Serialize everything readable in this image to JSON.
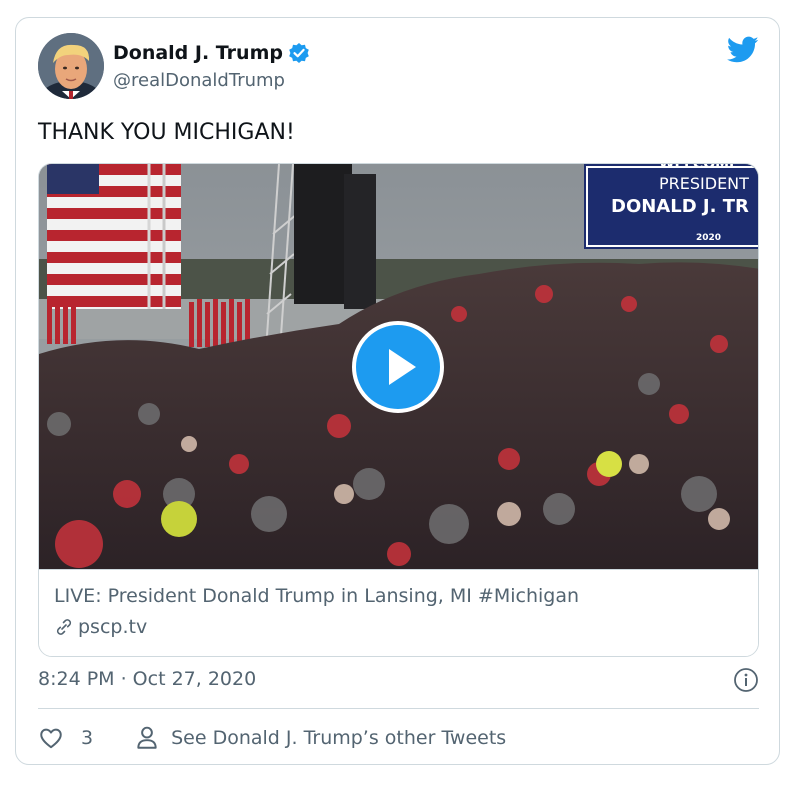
{
  "author": {
    "display_name": "Donald J. Trump",
    "handle": "@realDonaldTrump"
  },
  "tweet": {
    "text": "THANK YOU MICHIGAN!"
  },
  "media": {
    "sign_line1": "WELCOME",
    "sign_line2": "PRESIDENT",
    "sign_line3": "DONALD J. TR",
    "sign_line4": "2020",
    "link_title": "LIVE: President Donald Trump in Lansing, MI #Michigan",
    "link_domain": "pscp.tv"
  },
  "meta": {
    "timestamp": "8:24 PM · Oct 27, 2020"
  },
  "actions": {
    "like_count": "3",
    "other_tweets_label": "See Donald J. Trump’s other Tweets"
  },
  "colors": {
    "twitter_blue": "#1d9bf0",
    "secondary_text": "#536471",
    "border": "#cfd9de"
  }
}
